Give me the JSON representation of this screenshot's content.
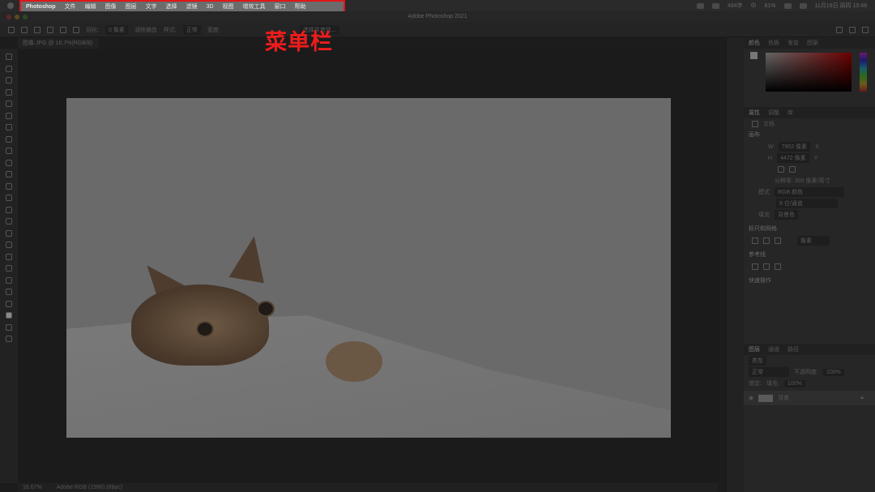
{
  "menubar": {
    "items": [
      "Photoshop",
      "文件",
      "编辑",
      "图像",
      "图层",
      "文字",
      "选择",
      "滤镜",
      "3D",
      "视图",
      "增效工具",
      "窗口",
      "帮助"
    ],
    "status": {
      "word_count": "494字",
      "ime": "中",
      "battery": "81%",
      "datetime": "11月18日 周四 10:48"
    }
  },
  "annotation": {
    "label": "菜单栏",
    "color": "#e0141b"
  },
  "window": {
    "title": "Adobe Photoshop 2021"
  },
  "options": {
    "feather_label": "羽化:",
    "feather_value": "0 像素",
    "antialias": "消除锯齿",
    "style_label": "样式:",
    "style_value": "正常",
    "width_label": "宽度:",
    "select_mask": "选择并遮住..."
  },
  "document": {
    "tab": "图像.JPG @ 16.7%(RGB/8)",
    "zoom": "16.67%",
    "profile": "Adobe RGB (1998) (8bpc)"
  },
  "panels": {
    "color_tabs": [
      "颜色",
      "色板",
      "渐变",
      "图案"
    ],
    "prop_tabs": [
      "属性",
      "调整",
      "库"
    ],
    "doc_label": "文档",
    "canvas": {
      "title": "画布",
      "w_label": "W",
      "w": "7952 像素",
      "h_label": "H",
      "h": "4472 像素",
      "x_label": "X",
      "y_label": "Y",
      "resolution": "分辨率: 300 像素/英寸",
      "mode_label": "模式",
      "mode": "RGB 颜色",
      "depth": "8 位/通道",
      "fill_label": "填充",
      "fill": "背景色"
    },
    "rulers": {
      "title": "标尺和网格",
      "unit": "像素"
    },
    "guides": {
      "title": "参考线"
    },
    "quick": {
      "title": "快速操作"
    },
    "layer_tabs": [
      "图层",
      "通道",
      "路径"
    ],
    "layers": {
      "filter": "类型",
      "blend": "正常",
      "opacity_label": "不透明度:",
      "opacity": "100%",
      "lock_label": "锁定:",
      "fill_label": "填充:",
      "fill": "100%",
      "items": [
        {
          "name": "背景"
        }
      ]
    }
  }
}
